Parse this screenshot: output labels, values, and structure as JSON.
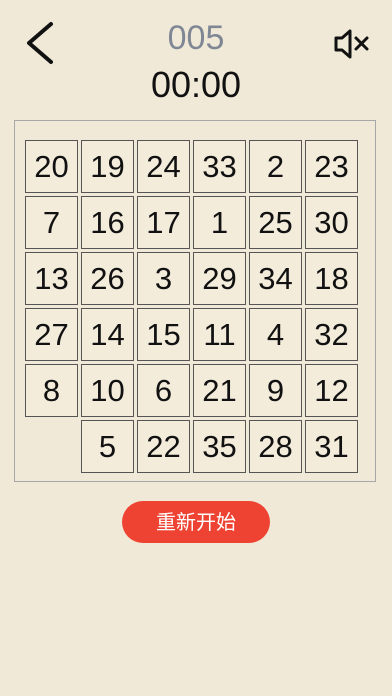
{
  "header": {
    "back_icon": "chevron-left-icon",
    "level": "005",
    "timer": "00:00",
    "mute_icon": "speaker-muted-icon"
  },
  "board": {
    "rows": 6,
    "cols": 6,
    "tiles": [
      [
        "20",
        "19",
        "24",
        "33",
        "2",
        "23"
      ],
      [
        "7",
        "16",
        "17",
        "1",
        "25",
        "30"
      ],
      [
        "13",
        "26",
        "3",
        "29",
        "34",
        "18"
      ],
      [
        "27",
        "14",
        "15",
        "11",
        "4",
        "32"
      ],
      [
        "8",
        "10",
        "6",
        "21",
        "9",
        "12"
      ],
      [
        null,
        "5",
        "22",
        "35",
        "28",
        "31"
      ]
    ]
  },
  "restart_label": "重新开始",
  "colors": {
    "background": "#f0e9d8",
    "level_text": "#808794",
    "restart_button": "#ee4332"
  }
}
